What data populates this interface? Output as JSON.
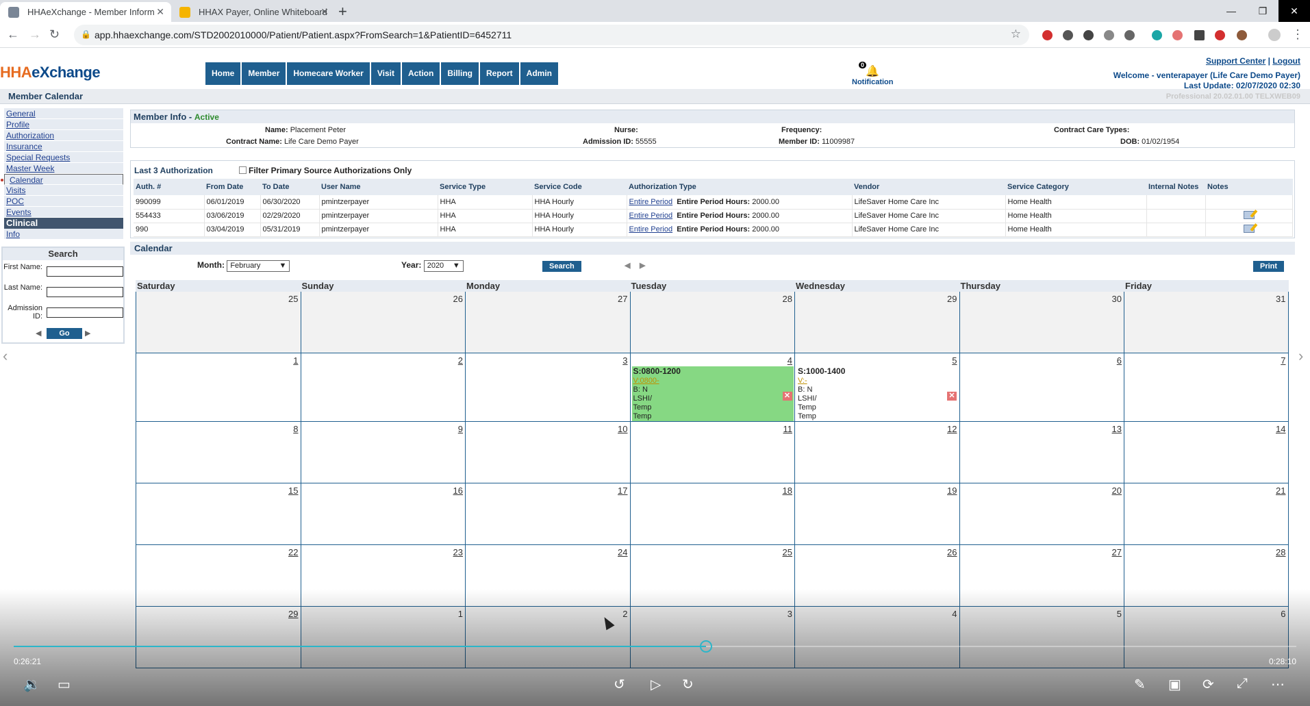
{
  "browser": {
    "tabs": [
      {
        "title": "HHAeXchange - Member Inform",
        "active": true
      },
      {
        "title": "HHAX Payer, Online Whiteboard",
        "active": false
      }
    ],
    "url": "app.hhaexchange.com/STD2002010000/Patient/Patient.aspx?FromSearch=1&PatientID=6452711"
  },
  "header": {
    "logo_part1": "HHA",
    "logo_part2": "eXchange",
    "nav": [
      "Home",
      "Member",
      "Homecare Worker",
      "Visit",
      "Action",
      "Billing",
      "Report",
      "Admin"
    ],
    "notification_label": "Notification",
    "notification_count": "0",
    "support_center": "Support Center",
    "separator": "|",
    "logout": "Logout",
    "welcome": "Welcome - venterapayer (Life Care Demo Payer)",
    "last_update": "Last Update: 02/07/2020 02:30"
  },
  "page": {
    "title": "Member Calendar",
    "version": "Professional 20.02.01.00  TELXWEB09"
  },
  "sidebar": {
    "links": [
      "General",
      "Profile",
      "Authorization",
      "Insurance",
      "Special Requests",
      "Master Week",
      "Calendar",
      "Visits",
      "POC",
      "Events"
    ],
    "section": "Clinical",
    "info": "Info"
  },
  "search": {
    "title": "Search",
    "first_name": "First Name:",
    "last_name": "Last Name:",
    "admission_id": "Admission ID:",
    "go": "Go"
  },
  "member_info": {
    "title": "Member Info",
    "sep": " - ",
    "status": "Active",
    "name_label": "Name:",
    "name": "Placement Peter",
    "contract_label": "Contract Name:",
    "contract": "Life Care Demo Payer",
    "nurse_label": "Nurse:",
    "admission_label": "Admission ID:",
    "admission": "55555",
    "frequency_label": "Frequency:",
    "member_id_label": "Member ID:",
    "member_id": "11009987",
    "care_types_label": "Contract Care Types:",
    "dob_label": "DOB:",
    "dob": "01/02/1954"
  },
  "authorization": {
    "title": "Last 3 Authorization",
    "filter_label": "Filter Primary Source Authorizations Only",
    "columns": [
      "Auth. #",
      "From Date",
      "To Date",
      "User Name",
      "Service Type",
      "Service Code",
      "Authorization Type",
      "Vendor",
      "Service Category",
      "Internal Notes",
      "Notes"
    ],
    "hours_label": "Entire Period Hours:",
    "rows": [
      {
        "auth": "990099",
        "from": "06/01/2019",
        "to": "06/30/2020",
        "user": "pmintzerpayer",
        "stype": "HHA",
        "scode": "HHA Hourly",
        "atype": "Entire Period",
        "hours": "2000.00",
        "vendor": "LifeSaver Home Care Inc",
        "category": "Home Health",
        "note": false
      },
      {
        "auth": "554433",
        "from": "03/06/2019",
        "to": "02/29/2020",
        "user": "pmintzerpayer",
        "stype": "HHA",
        "scode": "HHA Hourly",
        "atype": "Entire Period",
        "hours": "2000.00",
        "vendor": "LifeSaver Home Care Inc",
        "category": "Home Health",
        "note": true
      },
      {
        "auth": "990",
        "from": "03/04/2019",
        "to": "05/31/2019",
        "user": "pmintzerpayer",
        "stype": "HHA",
        "scode": "HHA Hourly",
        "atype": "Entire Period",
        "hours": "2000.00",
        "vendor": "LifeSaver Home Care Inc",
        "category": "Home Health",
        "note": true
      }
    ]
  },
  "calendar": {
    "title": "Calendar",
    "month_label": "Month:",
    "month": "February",
    "year_label": "Year:",
    "year": "2020",
    "search": "Search",
    "print": "Print",
    "days": [
      "Saturday",
      "Sunday",
      "Monday",
      "Tuesday",
      "Wednesday",
      "Thursday",
      "Friday"
    ],
    "weeks": [
      [
        "25",
        "26",
        "27",
        "28",
        "29",
        "30",
        "31"
      ],
      [
        "1",
        "2",
        "3",
        "4",
        "5",
        "6",
        "7"
      ],
      [
        "8",
        "9",
        "10",
        "11",
        "12",
        "13",
        "14"
      ],
      [
        "15",
        "16",
        "17",
        "18",
        "19",
        "20",
        "21"
      ],
      [
        "22",
        "23",
        "24",
        "25",
        "26",
        "27",
        "28"
      ],
      [
        "29",
        "1",
        "2",
        "3",
        "4",
        "5",
        "6"
      ]
    ],
    "visits": [
      {
        "time": "S:0800-1200",
        "v": "V:0800-",
        "b": "B: N",
        "lshi": "LSHI/",
        "t1": "Temp",
        "t2": "Temp"
      },
      {
        "time": "S:1000-1400",
        "v": "V:-",
        "b": "B: N",
        "lshi": "LSHI/",
        "t1": "Temp",
        "t2": "Temp"
      }
    ]
  },
  "video": {
    "elapsed": "0:26:21",
    "total": "0:28:10",
    "progress": 0.54,
    "accent": "#2bb6c9"
  }
}
